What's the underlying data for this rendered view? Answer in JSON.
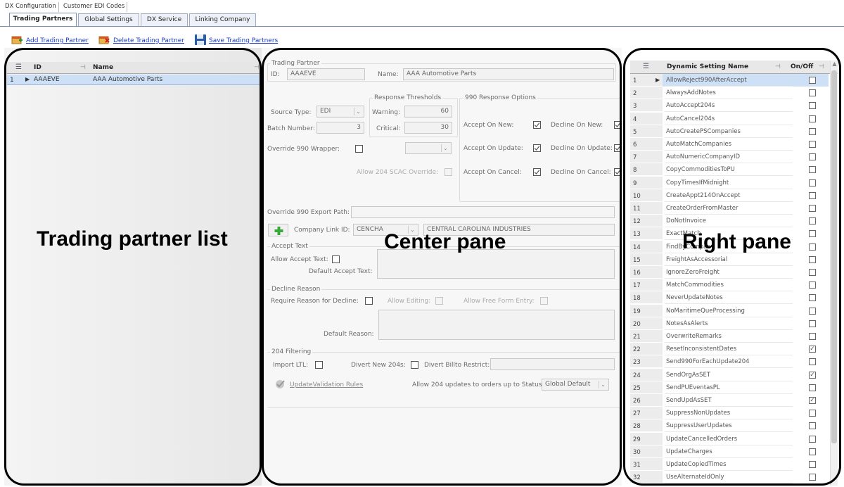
{
  "top_tabs": [
    "DX Configuration",
    "Customer EDI Codes"
  ],
  "sub_tabs": [
    "Trading Partners",
    "Global Settings",
    "DX Service",
    "Linking Company"
  ],
  "toolbar": {
    "add": "Add Trading Partner",
    "delete": "Delete Trading Partner",
    "save": "Save Trading Partners"
  },
  "left_grid": {
    "col_id": "ID",
    "col_name": "Name",
    "rows": [
      {
        "num": "1",
        "id": "AAAEVE",
        "name": "AAA Automotive Parts"
      }
    ]
  },
  "annotations": {
    "left": "Trading partner list",
    "center": "Center pane",
    "right": "Right pane"
  },
  "center": {
    "trading_partner_group": "Trading Partner",
    "id_label": "ID:",
    "id_value": "AAAEVE",
    "name_label": "Name:",
    "name_value": "AAA Automotive Parts",
    "response_thresholds": "Response Thresholds",
    "warning_label": "Warning:",
    "warning_value": "60",
    "critical_label": "Critical:",
    "critical_value": "30",
    "source_type_label": "Source Type:",
    "source_type_value": "EDI",
    "batch_number_label": "Batch Number:",
    "batch_number_value": "3",
    "override_990_wrapper_label": "Override 990 Wrapper:",
    "allow_204_scac_label": "Allow 204 SCAC Override:",
    "response_990_options": "990 Response Options",
    "accept_on_new": "Accept On New:",
    "accept_on_update": "Accept On Update:",
    "accept_on_cancel": "Accept On Cancel:",
    "decline_on_new": "Decline On New:",
    "decline_on_update": "Decline On Update:",
    "decline_on_cancel": "Decline On Cancel:",
    "override_export_path_label": "Override 990 Export Path:",
    "company_link_label": "Company Link ID:",
    "company_link_value": "CENCHA",
    "company_link_name": "CENTRAL CAROLINA INDUSTRIES",
    "accept_text_group": "Accept Text",
    "allow_accept_text": "Allow Accept Text:",
    "default_accept_text": "Default Accept Text:",
    "decline_reason_group": "Decline Reason",
    "require_reason": "Require Reason for Decline:",
    "allow_editing": "Allow Editing:",
    "allow_free_form": "Allow Free Form Entry:",
    "default_reason": "Default Reason:",
    "filtering_group": "204 Filtering",
    "import_ltl": "Import LTL:",
    "divert_new_204s": "Divert New 204s:",
    "divert_billto": "Divert Billto Restrict:",
    "update_validation_rules": "UpdateValidation Rules",
    "allow_204_updates_label": "Allow 204 updates to orders up to Status:",
    "allow_204_updates_value": "Global Default"
  },
  "right_grid": {
    "col_name": "Dynamic Setting Name",
    "col_onoff": "On/Off",
    "rows": [
      {
        "num": "1",
        "name": "AllowReject990AfterAccept",
        "on": false
      },
      {
        "num": "2",
        "name": "AlwaysAddNotes",
        "on": false
      },
      {
        "num": "3",
        "name": "AutoAccept204s",
        "on": false
      },
      {
        "num": "4",
        "name": "AutoCancel204s",
        "on": false
      },
      {
        "num": "5",
        "name": "AutoCreatePSCompanies",
        "on": false
      },
      {
        "num": "6",
        "name": "AutoMatchCompanies",
        "on": false
      },
      {
        "num": "7",
        "name": "AutoNumericCompanyID",
        "on": false
      },
      {
        "num": "8",
        "name": "CopyCommoditiesToPU",
        "on": false
      },
      {
        "num": "9",
        "name": "CopyTimesIfMidnight",
        "on": false
      },
      {
        "num": "10",
        "name": "CreateAppt214OnAccept",
        "on": false
      },
      {
        "num": "11",
        "name": "CreateOrderFromMaster",
        "on": false
      },
      {
        "num": "12",
        "name": "DoNotInvoice",
        "on": false
      },
      {
        "num": "13",
        "name": "ExactMatch",
        "on": false
      },
      {
        "num": "14",
        "name": "FindByCompany",
        "on": false
      },
      {
        "num": "15",
        "name": "FreightAsAccessorial",
        "on": false
      },
      {
        "num": "16",
        "name": "IgnoreZeroFreight",
        "on": false
      },
      {
        "num": "17",
        "name": "MatchCommodities",
        "on": false
      },
      {
        "num": "18",
        "name": "NeverUpdateNotes",
        "on": false
      },
      {
        "num": "19",
        "name": "NoMaritimeQueProcessing",
        "on": false
      },
      {
        "num": "20",
        "name": "NotesAsAlerts",
        "on": false
      },
      {
        "num": "21",
        "name": "OverwriteRemarks",
        "on": false
      },
      {
        "num": "22",
        "name": "ResetInconsistentDates",
        "on": true
      },
      {
        "num": "23",
        "name": "Send990ForEachUpdate204",
        "on": false
      },
      {
        "num": "24",
        "name": "SendOrgAsSET",
        "on": true
      },
      {
        "num": "25",
        "name": "SendPUEventasPL",
        "on": false
      },
      {
        "num": "26",
        "name": "SendUpdAsSET",
        "on": true
      },
      {
        "num": "27",
        "name": "SuppressNonUpdates",
        "on": false
      },
      {
        "num": "28",
        "name": "SuppressUserUpdates",
        "on": false
      },
      {
        "num": "29",
        "name": "UpdateCancelledOrders",
        "on": false
      },
      {
        "num": "30",
        "name": "UpdateCharges",
        "on": false
      },
      {
        "num": "31",
        "name": "UpdateCopiedTimes",
        "on": false
      },
      {
        "num": "32",
        "name": "UseAlternateIdOnly",
        "on": false
      }
    ]
  }
}
